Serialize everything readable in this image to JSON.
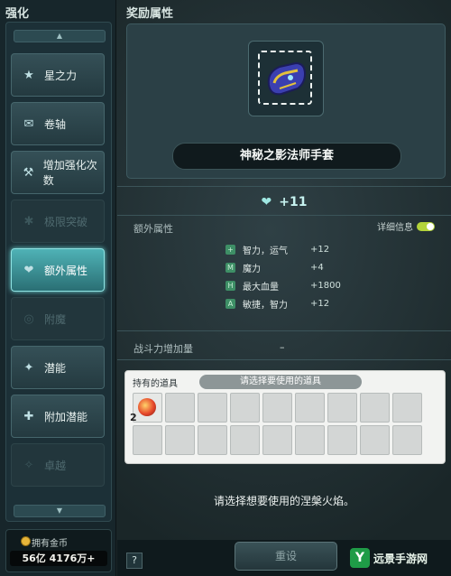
{
  "left": {
    "title": "强化",
    "scroll_up": "▲",
    "scroll_down": "▼",
    "menu": [
      {
        "label": "星之力",
        "icon": "star-icon",
        "glyph": "★",
        "state": "enabled"
      },
      {
        "label": "卷轴",
        "icon": "scroll-icon",
        "glyph": "✉",
        "state": "enabled"
      },
      {
        "label": "增加强化次数",
        "icon": "hammer-icon",
        "glyph": "⚒",
        "state": "enabled"
      },
      {
        "label": "极限突破",
        "icon": "burst-icon",
        "glyph": "✱",
        "state": "disabled"
      },
      {
        "label": "额外属性",
        "icon": "heart-icon",
        "glyph": "❤",
        "state": "active"
      },
      {
        "label": "附魔",
        "icon": "swirl-icon",
        "glyph": "◎",
        "state": "disabled"
      },
      {
        "label": "潜能",
        "icon": "sparkle-icon",
        "glyph": "✦",
        "state": "enabled"
      },
      {
        "label": "附加潜能",
        "icon": "sparkle-plus-icon",
        "glyph": "✚",
        "state": "enabled"
      },
      {
        "label": "卓越",
        "icon": "gem-icon",
        "glyph": "✧",
        "state": "disabled"
      }
    ],
    "gold": {
      "label": "拥有金币",
      "value": "56亿 4176万+"
    }
  },
  "right": {
    "title": "奖励属性",
    "item_name": "神秘之影法师手套",
    "level": "+11",
    "extra_label": "额外属性",
    "detail_label": "详细信息",
    "stats": [
      {
        "name": "智力，运气",
        "value": "+12"
      },
      {
        "name": "魔力",
        "value": "+4"
      },
      {
        "name": "最大血量",
        "value": "+1800"
      },
      {
        "name": "敏捷，智力",
        "value": "+12"
      }
    ],
    "power_label": "战斗力增加量",
    "power_value": "–",
    "inventory": {
      "owned_label": "持有的道具",
      "select_label": "请选择要使用的道具",
      "first_item_qty": "2"
    },
    "message": "请选择想要使用的涅槃火焰。",
    "reset_label": "重设",
    "help_label": "?",
    "watermark": "远景手游网",
    "watermark_logo": "Y"
  },
  "colors": {
    "accent": "#4fb2b6",
    "toggle_on": "#b3d33a",
    "stat_icon": "#3e8f66"
  }
}
